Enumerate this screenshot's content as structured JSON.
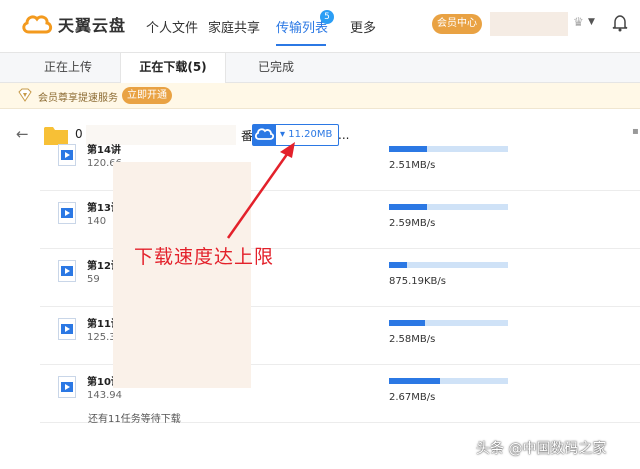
{
  "header": {
    "logo_text": "天翼云盘",
    "nav": [
      "个人文件",
      "家庭共享",
      "传输列表",
      "更多"
    ],
    "active_nav_index": 2,
    "transfer_badge": "5",
    "vip_label": "会员中心"
  },
  "tabs": [
    "正在上传",
    "正在下载(5)",
    "已完成"
  ],
  "active_tab_index": 1,
  "promo": {
    "text": "会员尊享提速服务",
    "button": "立即开通"
  },
  "folder": {
    "name_start": "0",
    "name_end": "番",
    "total_speed": "11.20MB",
    "ellipsis": "..."
  },
  "downloads": [
    {
      "name": "第14讲",
      "size": "120.66",
      "speed": "2.51MB/s",
      "progress": 0.32
    },
    {
      "name": "第13讲",
      "size": "140",
      "speed": "2.59MB/s",
      "progress": 0.32
    },
    {
      "name": "第12讲",
      "size": "59",
      "speed": "875.19KB/s",
      "progress": 0.15
    },
    {
      "name": "第11讲",
      "size": "125.30",
      "speed": "2.58MB/s",
      "progress": 0.3
    },
    {
      "name": "第10讲",
      "size": "143.94",
      "speed": "2.67MB/s",
      "progress": 0.43
    }
  ],
  "pending_text": "还有11任务等待下载",
  "annotation": "下载速度达上限",
  "watermark": "头条 @中国数码之家",
  "colors": {
    "accent": "#2b78e4",
    "vip": "#e9a243",
    "annotation": "#e3212b"
  }
}
